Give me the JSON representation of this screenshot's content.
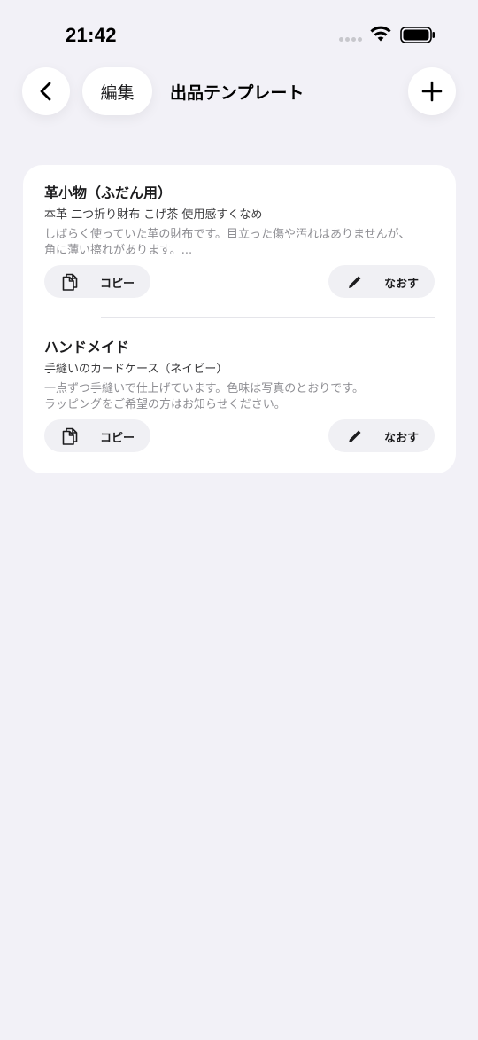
{
  "status_bar": {
    "time": "21:42"
  },
  "nav": {
    "back_icon": "chevron-left-icon",
    "edit_label": "編集",
    "title": "出品テンプレート",
    "add_icon": "plus-icon"
  },
  "templates": [
    {
      "title": "革小物（ふだん用）",
      "subtitle": "本革 二つ折り財布 こげ茶 使用感すくなめ",
      "description": "しばらく使っていた革の財布です。目立った傷や汚れはありませんが、\n角に薄い擦れがあります。...",
      "copy_label": "コピー",
      "edit_label": "なおす"
    },
    {
      "title": "ハンドメイド",
      "subtitle": "手縫いのカードケース（ネイビー）",
      "description": "一点ずつ手縫いで仕上げています。色味は写真のとおりです。\nラッピングをご希望の方はお知らせください。",
      "copy_label": "コピー",
      "edit_label": "なおす"
    }
  ],
  "colors": {
    "background": "#f2f1f7",
    "card": "#ffffff",
    "button_bg": "#f0f0f4",
    "muted_text": "#8e8e93"
  }
}
